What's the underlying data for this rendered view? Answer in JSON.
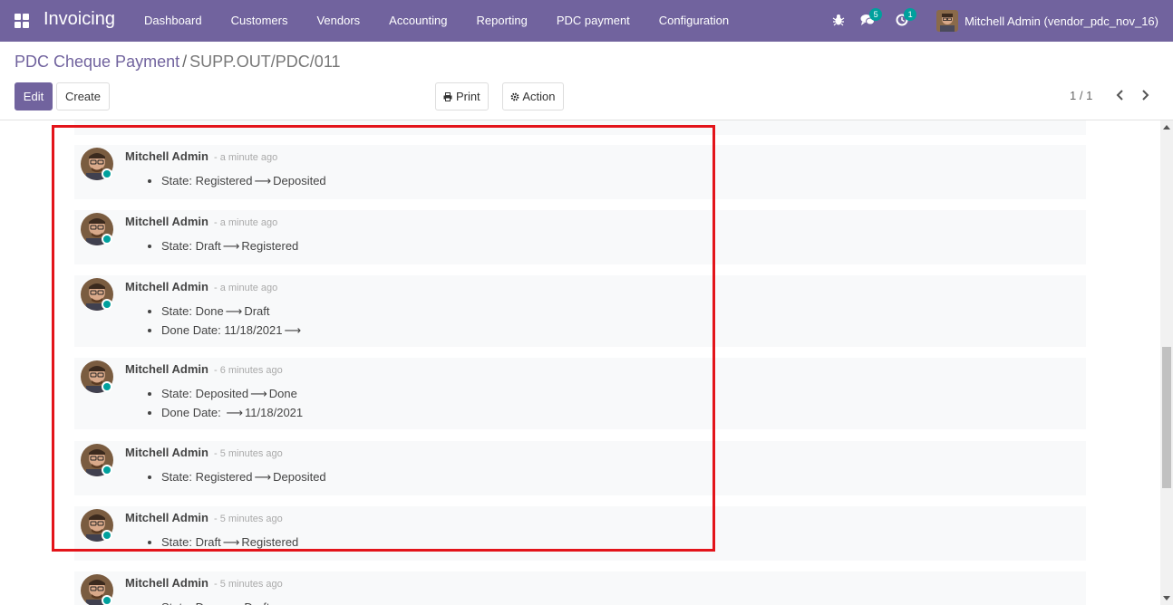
{
  "navbar": {
    "brand": "Invoicing",
    "menu": [
      "Dashboard",
      "Customers",
      "Vendors",
      "Accounting",
      "Reporting",
      "PDC payment",
      "Configuration"
    ],
    "messages_badge": "5",
    "activities_badge": "1",
    "user_name": "Mitchell Admin (vendor_pdc_nov_16)"
  },
  "breadcrumb": {
    "parent": "PDC Cheque Payment",
    "separator": "/",
    "current": "SUPP.OUT/PDC/011"
  },
  "buttons": {
    "edit": "Edit",
    "create": "Create",
    "print": "Print",
    "action": "Action"
  },
  "pager": {
    "value": "1 / 1"
  },
  "colors": {
    "brand": "#71639e",
    "presence": "#00a09d",
    "highlight": "#e3141a"
  },
  "messages": [
    {
      "author": "Mitchell Admin",
      "date": "- a minute ago",
      "changes": [
        {
          "field": "State:",
          "old": "Registered",
          "arrow": "⟶",
          "new": "Deposited"
        }
      ]
    },
    {
      "author": "Mitchell Admin",
      "date": "- a minute ago",
      "changes": [
        {
          "field": "State:",
          "old": "Draft",
          "arrow": "⟶",
          "new": "Registered"
        }
      ]
    },
    {
      "author": "Mitchell Admin",
      "date": "- a minute ago",
      "changes": [
        {
          "field": "State:",
          "old": "Done",
          "arrow": "⟶",
          "new": "Draft"
        },
        {
          "field": "Done Date:",
          "old": "11/18/2021",
          "arrow": "⟶",
          "new": ""
        }
      ]
    },
    {
      "author": "Mitchell Admin",
      "date": "- 6 minutes ago",
      "changes": [
        {
          "field": "State:",
          "old": "Deposited",
          "arrow": "⟶",
          "new": "Done"
        },
        {
          "field": "Done Date:",
          "old": "",
          "arrow": "⟶",
          "new": "11/18/2021"
        }
      ]
    },
    {
      "author": "Mitchell Admin",
      "date": "- 5 minutes ago",
      "changes": [
        {
          "field": "State:",
          "old": "Registered",
          "arrow": "⟶",
          "new": "Deposited"
        }
      ]
    },
    {
      "author": "Mitchell Admin",
      "date": "- 5 minutes ago",
      "changes": [
        {
          "field": "State:",
          "old": "Draft",
          "arrow": "⟶",
          "new": "Registered"
        }
      ]
    },
    {
      "author": "Mitchell Admin",
      "date": "- 5 minutes ago",
      "changes": [
        {
          "field": "State:",
          "old": "Done",
          "arrow": "⟶",
          "new": "Draft"
        }
      ]
    }
  ]
}
